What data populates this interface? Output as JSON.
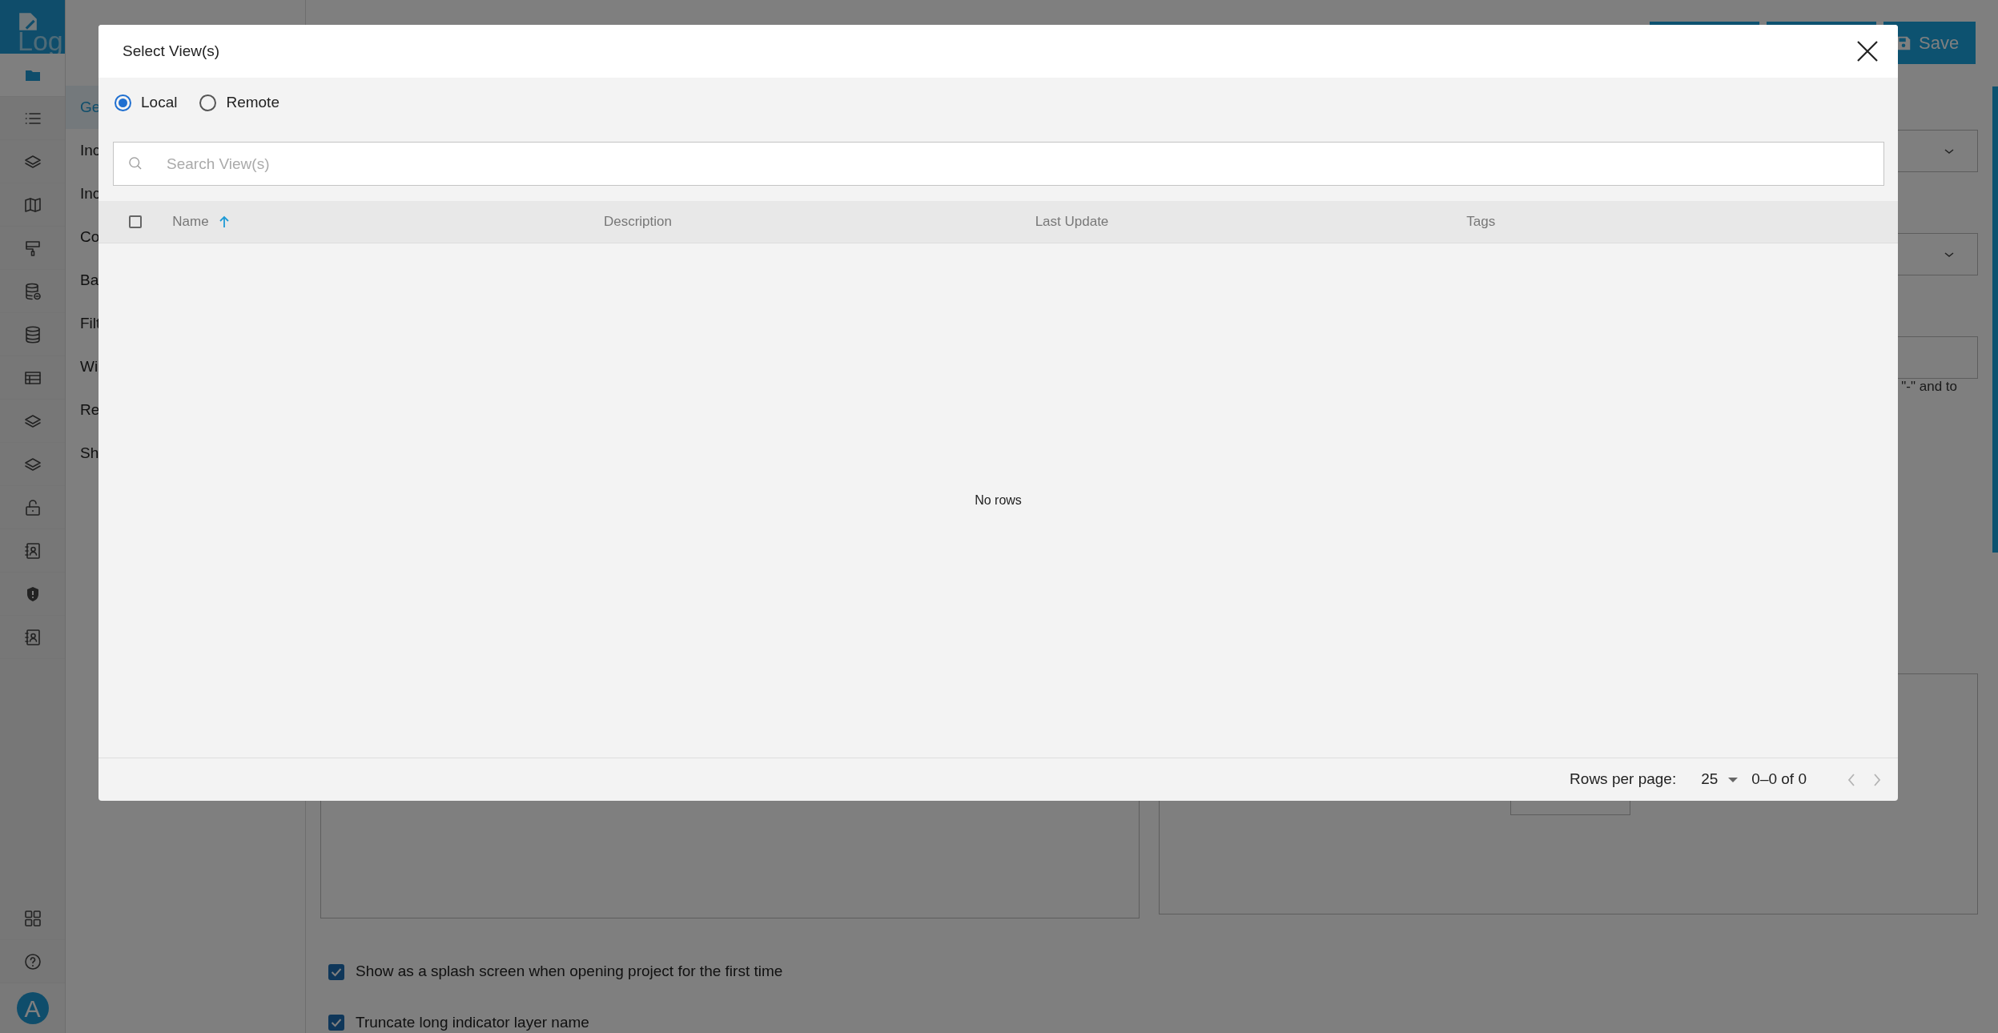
{
  "sidebar": {
    "logo": "Log",
    "items": [
      {
        "kind": "folder",
        "selected": true
      },
      {
        "kind": "list",
        "selected": false
      },
      {
        "kind": "layers",
        "selected": false
      },
      {
        "kind": "map",
        "selected": false
      },
      {
        "kind": "paint",
        "selected": false
      },
      {
        "kind": "database-plus",
        "selected": false
      },
      {
        "kind": "database",
        "selected": false
      },
      {
        "kind": "table",
        "selected": false
      },
      {
        "kind": "layers",
        "selected": false
      },
      {
        "kind": "layers",
        "selected": false
      },
      {
        "kind": "unlock",
        "selected": false
      },
      {
        "kind": "contacts",
        "selected": false
      },
      {
        "kind": "shield",
        "selected": false
      },
      {
        "kind": "contacts",
        "selected": false
      }
    ],
    "bottom_items": [
      {
        "kind": "grid"
      },
      {
        "kind": "help"
      }
    ],
    "avatar": "A"
  },
  "submenu": [
    {
      "label": "Ge",
      "selected": true
    },
    {
      "label": "Inc",
      "selected": false
    },
    {
      "label": "Inc",
      "selected": false
    },
    {
      "label": "Co",
      "selected": false
    },
    {
      "label": "Ba",
      "selected": false
    },
    {
      "label": "Filt",
      "selected": false
    },
    {
      "label": "Wi",
      "selected": false
    },
    {
      "label": "Re",
      "selected": false
    },
    {
      "label": "Sh",
      "selected": false
    }
  ],
  "toolbar": {
    "save_button": "Save"
  },
  "form": {
    "helper_text": "\"-\" and to",
    "checkboxes": [
      {
        "label": "Show as a splash screen when opening project for the first time",
        "checked": true
      },
      {
        "label": "Truncate long indicator layer name",
        "checked": true
      }
    ]
  },
  "dialog": {
    "title": "Select View(s)",
    "source_options": [
      {
        "label": "Local",
        "selected": true
      },
      {
        "label": "Remote",
        "selected": false
      }
    ],
    "search": {
      "placeholder": "Search View(s)"
    },
    "table": {
      "select_all_checked": false,
      "columns": [
        {
          "label": "Name",
          "sorted": true
        },
        {
          "label": "Description",
          "sorted": false
        },
        {
          "label": "Last Update",
          "sorted": false
        },
        {
          "label": "Tags",
          "sorted": false
        }
      ],
      "empty_text": "No rows"
    },
    "footer": {
      "rows_per_page_label": "Rows per page:",
      "rows_per_page": "25",
      "range": "0–0 of 0",
      "prev_disabled": true,
      "next_disabled": true
    }
  }
}
